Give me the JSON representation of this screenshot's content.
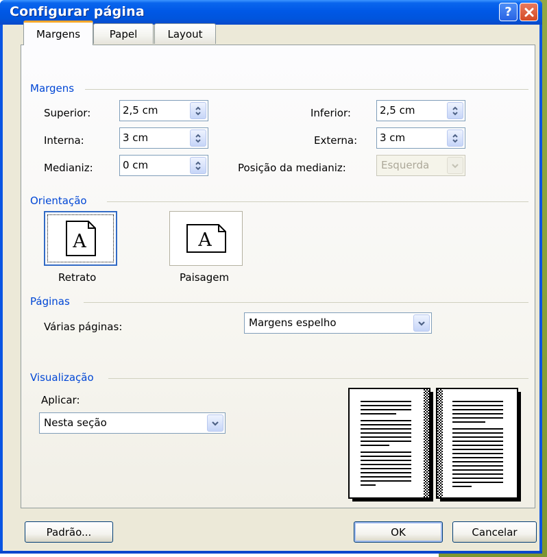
{
  "window": {
    "title": "Configurar página",
    "help_button": "?",
    "close_button": "X"
  },
  "tabs": [
    {
      "label": "Margens",
      "active": true
    },
    {
      "label": "Papel",
      "active": false
    },
    {
      "label": "Layout",
      "active": false
    }
  ],
  "margins": {
    "section_label": "Margens",
    "superior_label": "Superior:",
    "superior_value": "2,5 cm",
    "inferior_label": "Inferior:",
    "inferior_value": "2,5 cm",
    "interna_label": "Interna:",
    "interna_value": "3 cm",
    "externa_label": "Externa:",
    "externa_value": "3 cm",
    "medianiz_label": "Medianiz:",
    "medianiz_value": "0 cm",
    "gutter_pos_label": "Posição da medianiz:",
    "gutter_pos_value": "Esquerda"
  },
  "orientation": {
    "section_label": "Orientação",
    "portrait_label": "Retrato",
    "landscape_label": "Paisagem",
    "icon_glyph": "A",
    "selected": "portrait"
  },
  "pages": {
    "section_label": "Páginas",
    "multiple_label": "Várias páginas:",
    "multiple_value": "Margens espelho"
  },
  "preview": {
    "section_label": "Visualização",
    "apply_label": "Aplicar:",
    "apply_value": "Nesta seção"
  },
  "buttons": {
    "default_label": "Padrão...",
    "ok_label": "OK",
    "cancel_label": "Cancelar"
  },
  "colors": {
    "title_bar": "#0058e6",
    "section_text": "#0046d5",
    "active_tab_accent": "#f7a82c",
    "dialog_bg": "#ece9d8",
    "desktop_green": "#8aa23a"
  }
}
